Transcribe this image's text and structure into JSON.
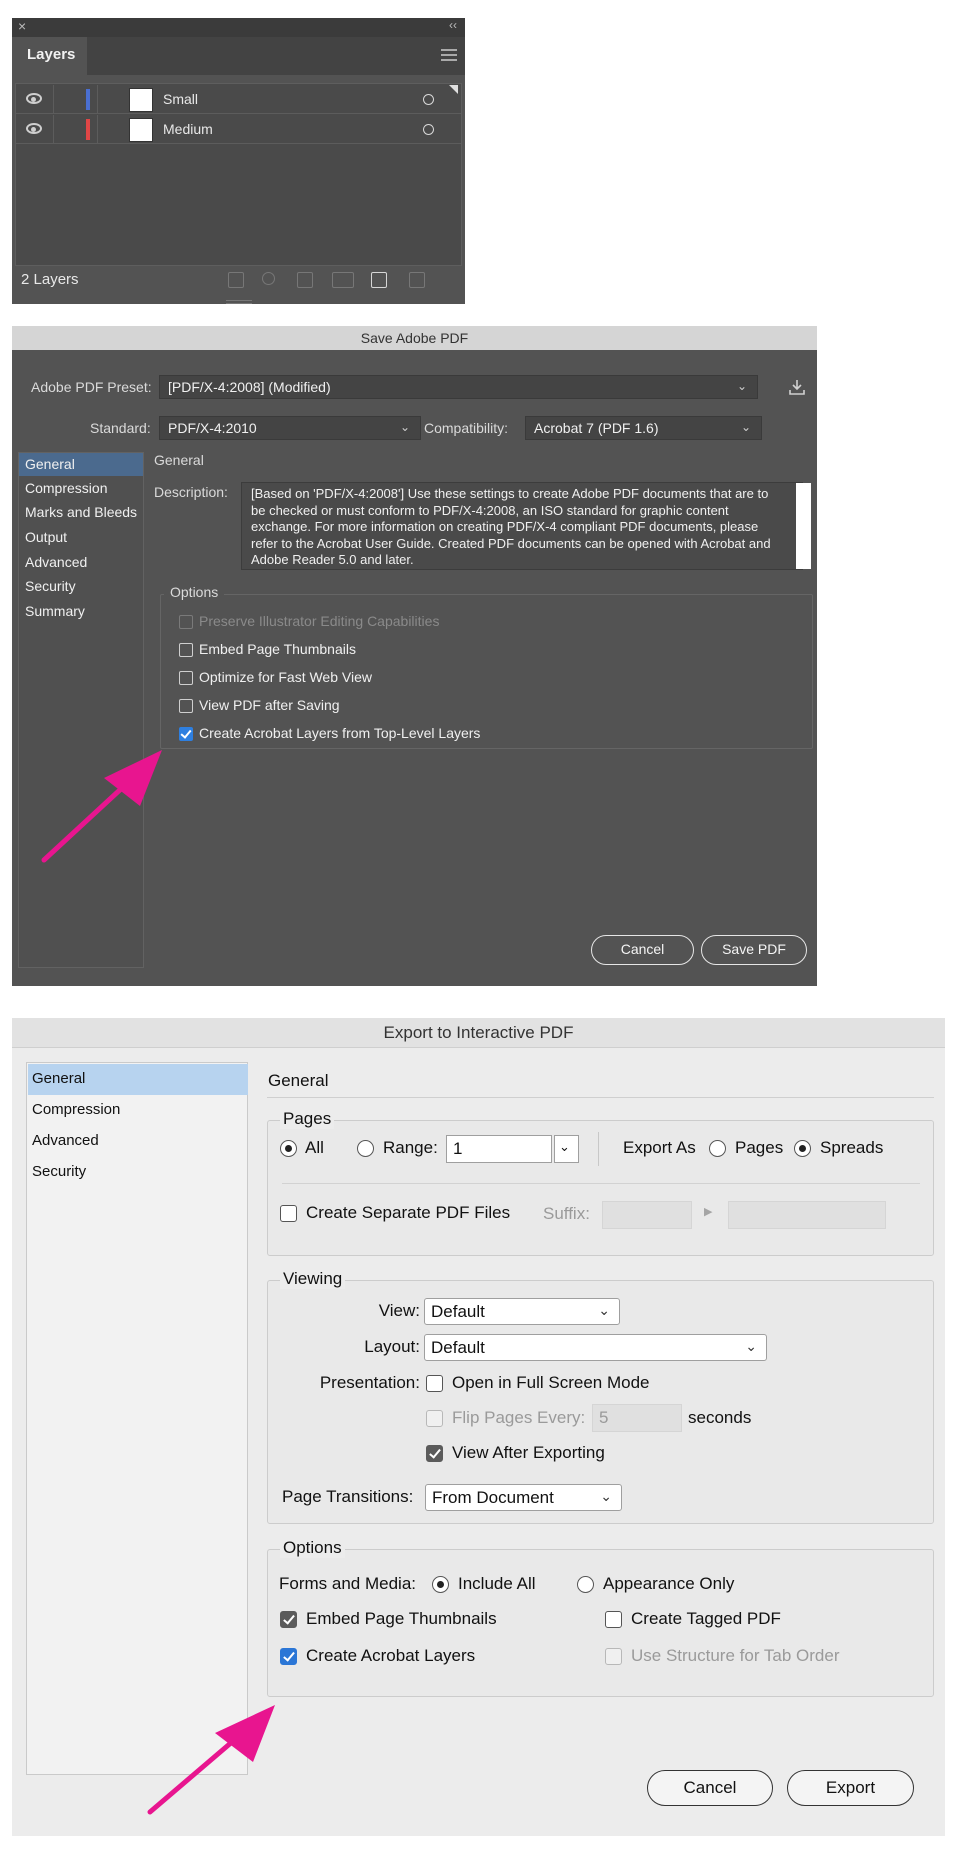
{
  "layers_panel": {
    "close_glyph": "×",
    "collapse_glyph": "‹‹",
    "tab_label": "Layers",
    "layers": [
      {
        "name": "Small",
        "color": "#4a6fd1"
      },
      {
        "name": "Medium",
        "color": "#e04646"
      }
    ],
    "status": "2 Layers",
    "footer_icons": [
      "export-icon",
      "search-icon",
      "collect-icon",
      "move-selection-icon",
      "new-layer-icon",
      "delete-icon"
    ]
  },
  "save_pdf": {
    "title": "Save Adobe PDF",
    "preset_label": "Adobe PDF Preset:",
    "preset_value": "[PDF/X-4:2008] (Modified)",
    "standard_label": "Standard:",
    "standard_value": "PDF/X-4:2010",
    "compat_label": "Compatibility:",
    "compat_value": "Acrobat 7 (PDF 1.6)",
    "sidebar": [
      "General",
      "Compression",
      "Marks and Bleeds",
      "Output",
      "Advanced",
      "Security",
      "Summary"
    ],
    "section_title": "General",
    "description_label": "Description:",
    "description_text": "[Based on 'PDF/X-4:2008'] Use these settings to create Adobe PDF documents that are to be checked or must conform to PDF/X-4:2008, an ISO standard for graphic content exchange.  For more information on creating PDF/X-4 compliant PDF documents, please refer to the Acrobat User Guide.  Created PDF documents can be opened with Acrobat and Adobe Reader 5.0 and later.",
    "options_label": "Options",
    "options": [
      {
        "label": "Preserve Illustrator Editing Capabilities",
        "checked": false,
        "disabled": true
      },
      {
        "label": "Embed Page Thumbnails",
        "checked": false,
        "disabled": false
      },
      {
        "label": "Optimize for Fast Web View",
        "checked": false,
        "disabled": false
      },
      {
        "label": "View PDF after Saving",
        "checked": false,
        "disabled": false
      },
      {
        "label": "Create Acrobat Layers from Top-Level Layers",
        "checked": true,
        "disabled": false
      }
    ],
    "cancel_label": "Cancel",
    "save_label": "Save PDF"
  },
  "export_pdf": {
    "title": "Export to Interactive PDF",
    "sidebar": [
      "General",
      "Compression",
      "Advanced",
      "Security"
    ],
    "section_title": "General",
    "pages": {
      "legend": "Pages",
      "all_label": "All",
      "range_label": "Range:",
      "range_value": "1",
      "export_as_label": "Export As",
      "pages_label": "Pages",
      "spreads_label": "Spreads",
      "separate_label": "Create Separate PDF Files",
      "suffix_label": "Suffix:"
    },
    "viewing": {
      "legend": "Viewing",
      "view_label": "View:",
      "view_value": "Default",
      "layout_label": "Layout:",
      "layout_value": "Default",
      "presentation_label": "Presentation:",
      "fullscreen_label": "Open in Full Screen Mode",
      "flip_label": "Flip Pages Every:",
      "flip_value": "5",
      "seconds_label": "seconds",
      "view_after_label": "View After Exporting",
      "transitions_label": "Page Transitions:",
      "transitions_value": "From Document"
    },
    "options": {
      "legend": "Options",
      "forms_label": "Forms and Media:",
      "include_all_label": "Include All",
      "appearance_only_label": "Appearance Only",
      "embed_thumbs_label": "Embed Page Thumbnails",
      "tagged_pdf_label": "Create Tagged PDF",
      "acrobat_layers_label": "Create Acrobat Layers",
      "structure_label": "Use Structure for Tab Order"
    },
    "cancel_label": "Cancel",
    "export_label": "Export"
  },
  "annotation_color": "#e8158f"
}
